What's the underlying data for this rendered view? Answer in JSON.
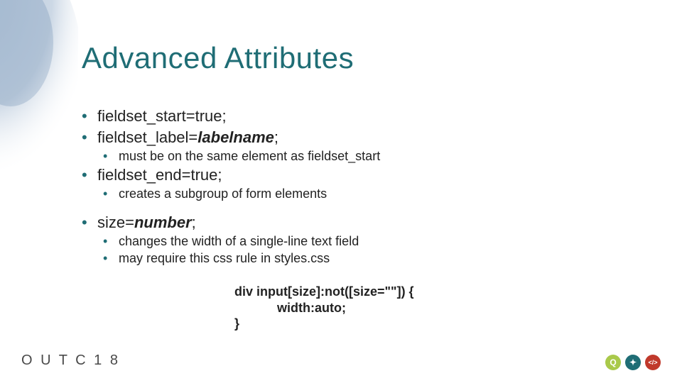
{
  "title": "Advanced Attributes",
  "bullets": {
    "b1": "fieldset_start=true;",
    "b2_pre": "fieldset_label=",
    "b2_ital": "labelname",
    "b2_post": ";",
    "b2a": "must be on the same element as fieldset_start",
    "b3": "fieldset_end=true;",
    "b3a": "creates a subgroup of form elements",
    "b4_pre": "size=",
    "b4_ital": "number",
    "b4_post": ";",
    "b4a": "changes the width of a single-line text field",
    "b4b": "may require this css rule in styles.css"
  },
  "code": "div input[size]:not([size=\"\"]) {\n            width:auto;\n}",
  "footer": {
    "logo": "O U T C 1 8"
  },
  "icons": {
    "a_color": "#a9c94a",
    "b_color": "#1f6d75",
    "c_color": "#c0392b",
    "a_glyph": "Q",
    "b_glyph": "✦",
    "c_glyph": "</>"
  }
}
